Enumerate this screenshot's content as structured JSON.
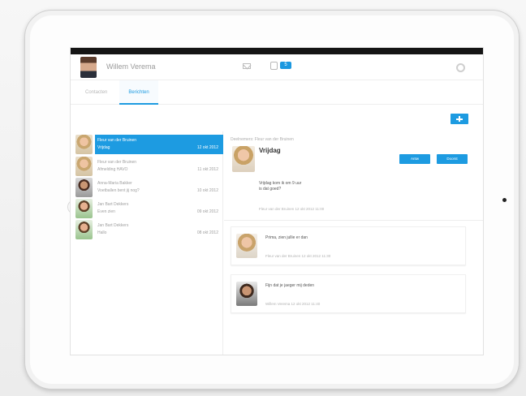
{
  "user": {
    "name": "Willem Verema",
    "unread_count": "5"
  },
  "tabs": [
    {
      "label": "Contacten"
    },
    {
      "label": "Berichten"
    }
  ],
  "message_list": [
    {
      "line1": "Fleur van der Bruinen",
      "line2": "Vrijdag",
      "date": "12 okt 2012"
    },
    {
      "line1": "Fleur van der Bruinen",
      "line2": "Afmelding HAVO",
      "date": "11 okt 2012"
    },
    {
      "line1": "Anna-Maria Bakker",
      "line2": "Voetballen bent jij nog?",
      "date": "10 okt 2012"
    },
    {
      "line1": "Jan Bart Dekkers",
      "line2": "Even zien",
      "date": "09 okt 2012"
    },
    {
      "line1": "Jan Bart Dekkers",
      "line2": "Hallo",
      "date": "08 okt 2012"
    }
  ],
  "conversation": {
    "participants": "Deelnemers: Fleur van der Bruinen",
    "subject": "Vrijdag",
    "reply_label": "Antw",
    "forward_label": "Doorst",
    "body": "Vrijdag kom ik om 9 uur\nis dat goed?",
    "meta": "Fleur van der Bruinen 12 okt 2012 11:00",
    "replies": [
      {
        "text": "Prima, zien jullie er dan",
        "meta": "Fleur van der Bruinen 12 okt 2012 11:30"
      },
      {
        "text": "Fijn dat je jaeger mij deden",
        "meta": "Willem Verema 12 okt 2012 11:40"
      }
    ]
  },
  "colors": {
    "accent": "#1d9be1",
    "statusbar": "#151515"
  },
  "icons": [
    "mail-icon",
    "chat-icon",
    "settings-icon",
    "compose-icon"
  ]
}
